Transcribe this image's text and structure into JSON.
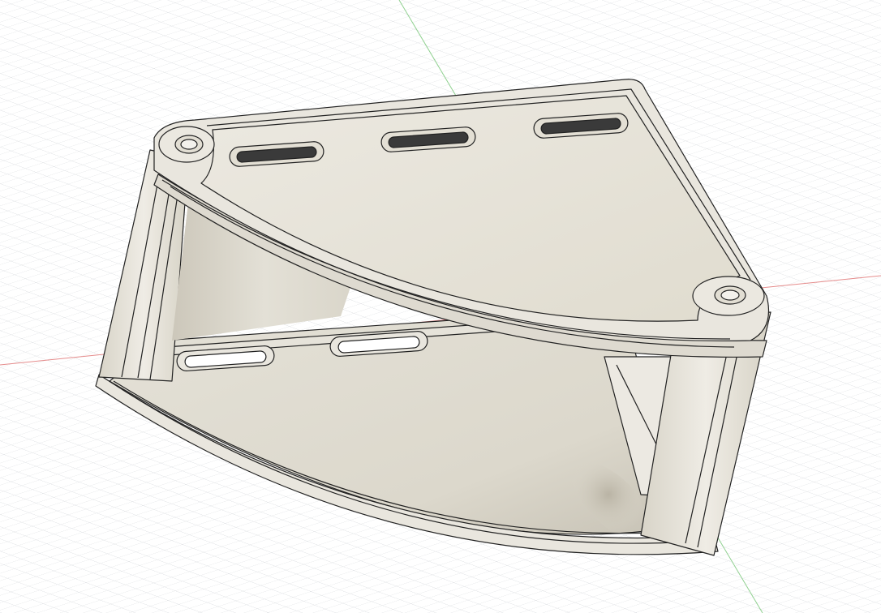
{
  "viewport": {
    "background": "#ffffff",
    "grid_color": "#d6d9dd",
    "axis_x_color": "#e07070",
    "axis_y_color": "#79c979"
  },
  "model": {
    "body_color": "#e8e5dc",
    "face_color": "#ddd9cd",
    "edge_color": "#1e1e1e",
    "slot_count_top": 3,
    "slot_count_bottom": 2
  }
}
